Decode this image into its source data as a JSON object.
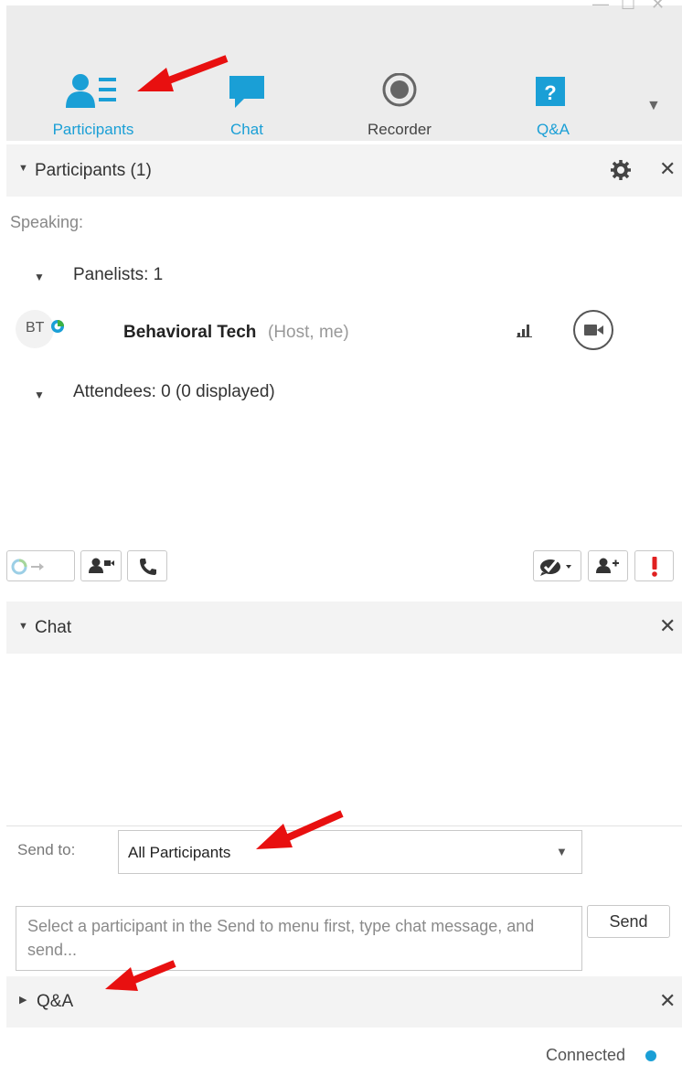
{
  "window": {
    "minimize": "—",
    "maximize": "☐",
    "close": "✕"
  },
  "toolbar": {
    "tabs": [
      {
        "label": "Participants",
        "icon": "participants-icon"
      },
      {
        "label": "Chat",
        "icon": "chat-icon"
      },
      {
        "label": "Recorder",
        "icon": "recorder-icon"
      },
      {
        "label": "Q&A",
        "icon": "qa-icon"
      }
    ],
    "more": "▼"
  },
  "participants": {
    "title": "Participants (1)",
    "speaking_label": "Speaking:",
    "panelists_label": "Panelists: 1",
    "attendees_label": "Attendees: 0 (0 displayed)",
    "person": {
      "initials": "BT",
      "name": "Behavioral Tech",
      "role": "(Host, me)"
    }
  },
  "chat": {
    "title": "Chat",
    "send_to_label": "Send to:",
    "send_to_value": "All Participants",
    "message_placeholder": "Select a participant in the Send to menu first, type chat message, and send...",
    "send_button": "Send"
  },
  "qa": {
    "title": "Q&A"
  },
  "status": {
    "text": "Connected"
  },
  "colors": {
    "accent": "#1a9fd6",
    "arrow": "#e81010",
    "alert": "#e02020",
    "header_bg": "#f3f3f3",
    "toolbar_bg": "#ececec"
  }
}
